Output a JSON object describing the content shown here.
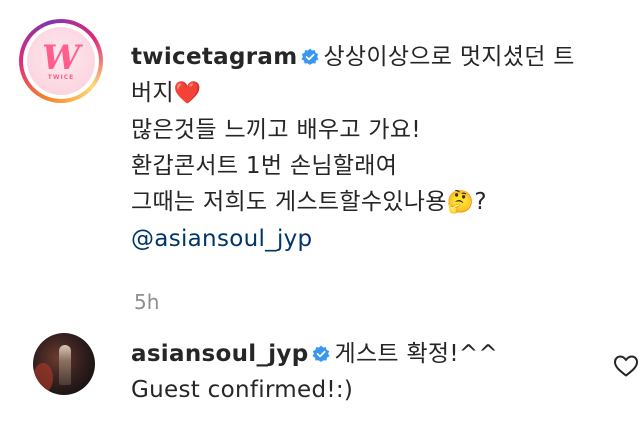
{
  "post": {
    "username": "twicetagram",
    "caption_line1": "상상이상으로 멋지셨던 트",
    "caption_line2": "버지",
    "caption_line2_emoji": "❤️",
    "caption_line3": "많은것들 느끼고 배우고 가요!",
    "caption_line4": "환갑콘서트 1번 손님할래여",
    "caption_line5": "그때는 저희도 게스트할수있나용",
    "caption_line5_emoji": "🤔",
    "caption_line5_tail": "?",
    "mention": "@asiansoul_jyp",
    "time": "5h",
    "avatar_logo": "W",
    "avatar_logo_text": "TWICE"
  },
  "comment": {
    "username": "asiansoul_jyp",
    "text_line1": "게스트 확정!^^",
    "text_line2": "Guest confirmed!:)"
  },
  "icons": {
    "verified": "verified-badge-icon",
    "like": "heart-outline-icon"
  },
  "colors": {
    "verified_blue": "#3897f0",
    "mention_blue": "#003569",
    "muted_gray": "#8e8e8e",
    "text": "#262626"
  }
}
